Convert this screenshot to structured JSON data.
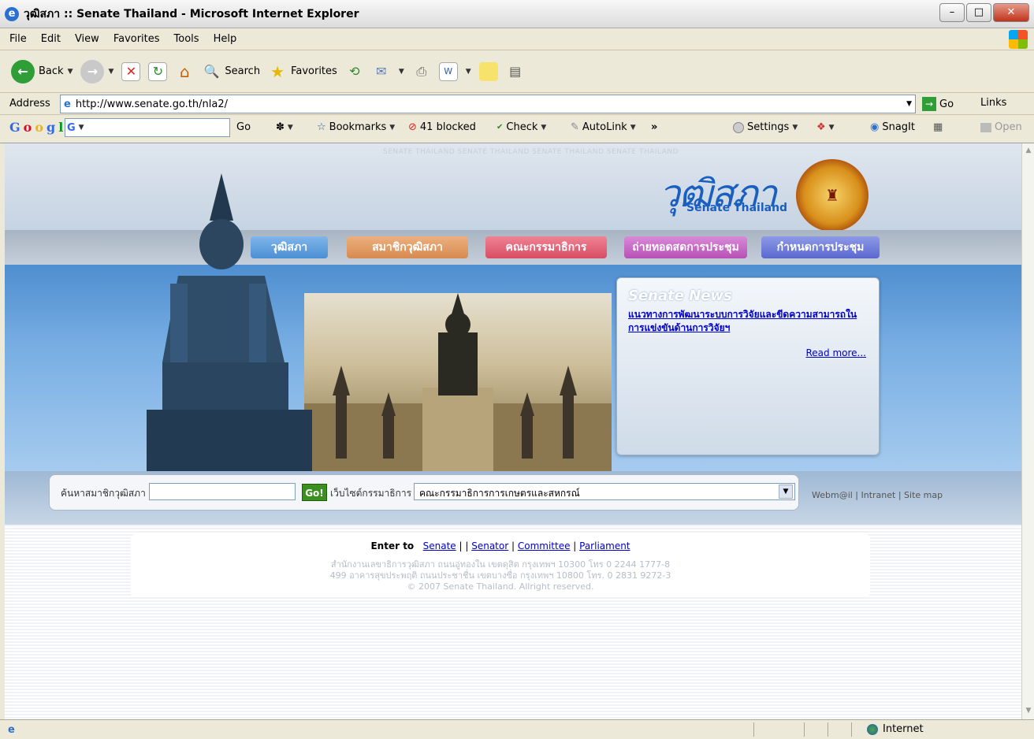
{
  "window": {
    "title": "วุฒิสภา :: Senate Thailand - Microsoft Internet Explorer"
  },
  "menu": [
    "File",
    "Edit",
    "View",
    "Favorites",
    "Tools",
    "Help"
  ],
  "toolbar": {
    "back": "Back",
    "search": "Search",
    "favorites": "Favorites"
  },
  "address": {
    "label": "Address",
    "url": "http://www.senate.go.th/nla2/",
    "go": "Go",
    "links": "Links"
  },
  "googlebar": {
    "go": "Go",
    "bookmarks": "Bookmarks",
    "blocked": "41 blocked",
    "check": "Check",
    "autolink": "AutoLink",
    "settings": "Settings",
    "snagit": "SnagIt",
    "open": "Open"
  },
  "page": {
    "header_watermark": "SENATE THAILAND SENATE THAILAND SENATE THAILAND SENATE THAILAND",
    "logo_text": "วุฒิสภา",
    "logo_sub": "Senate Thailand",
    "nav": [
      "วุฒิสภา",
      "สมาชิกวุฒิสภา",
      "คณะกรรมาธิการ",
      "ถ่ายทอดสดการประชุม",
      "กำหนดการประชุม"
    ],
    "news": {
      "title": "Senate News",
      "headline": "แนวทางการพัฒนาระบบการวิจัยและขีดความสามารถในการแข่งขันด้านการวิจัยฯ",
      "read_more": "Read more..."
    },
    "search": {
      "member_label": "ค้นหาสมาชิกวุฒิสภา",
      "go": "Go!",
      "committee_label": "เว็บไซต์กรรมาธิการ",
      "committee_selected": "คณะกรรมาธิการการเกษตรและสหกรณ์"
    },
    "toplinks": "Webm@il  |  Intranet  |  Site map",
    "footer": {
      "enter_to": "Enter to",
      "links": [
        "Senate",
        "Senator",
        "Committee",
        "Parliament"
      ],
      "line1": "สำนักงานเลขาธิการวุฒิสภา ถนนอู่ทองใน เขตดุสิต กรุงเทพฯ 10300 โทร 0 2244 1777-8",
      "line2": "499 อาคารสุขประพฤติ ถนนประชาชื่น เขตบางซื่อ กรุงเทพฯ 10800 โทร. 0 2831 9272-3",
      "line3": "© 2007 Senate Thailand. Allright reserved."
    }
  },
  "status": {
    "zone": "Internet"
  },
  "colors": {
    "nav1": "#5b9ee0",
    "nav2": "#e09a5b",
    "nav3": "#e05a6e",
    "nav4": "#c35fc2",
    "nav5": "#6a78d8"
  }
}
